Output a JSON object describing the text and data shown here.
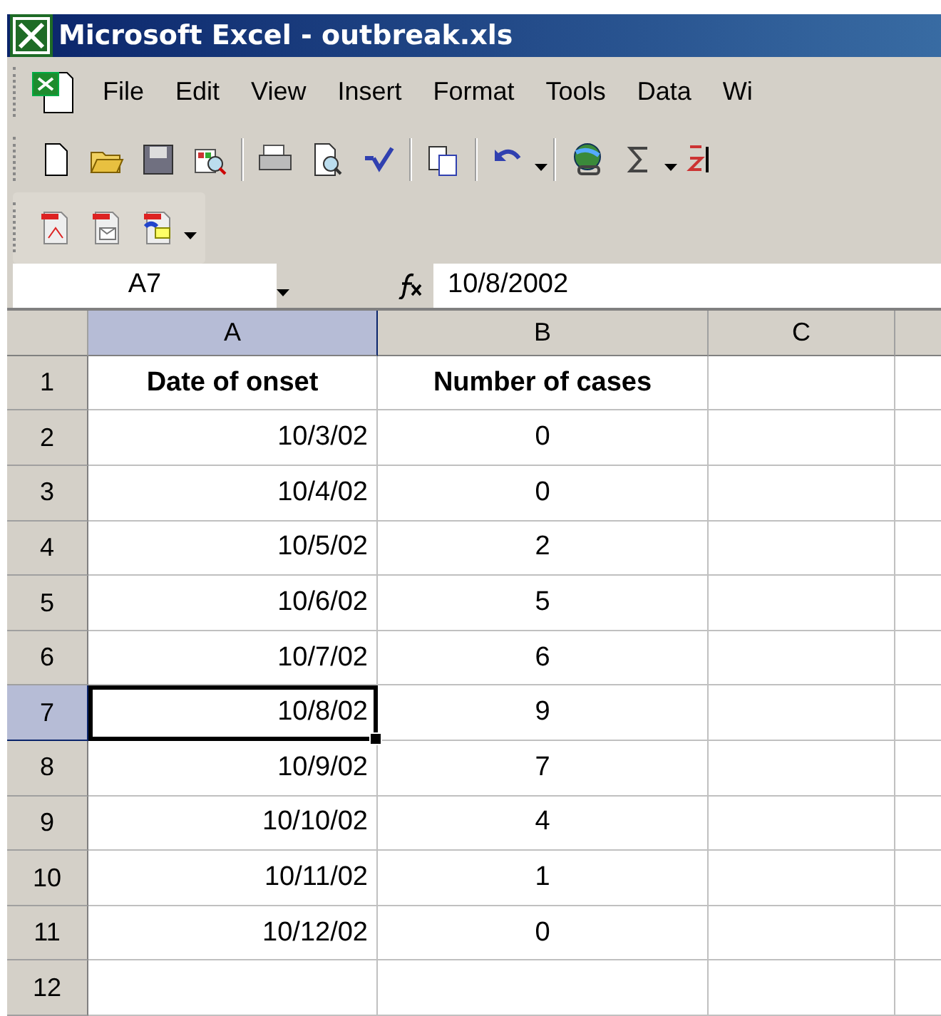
{
  "window": {
    "title": "Microsoft Excel - outbreak.xls"
  },
  "menu": [
    "File",
    "Edit",
    "View",
    "Insert",
    "Format",
    "Tools",
    "Data",
    "Wi"
  ],
  "name_box": {
    "value": "A7"
  },
  "formula_bar": {
    "value": "10/8/2002"
  },
  "columns": [
    {
      "label": "A",
      "selected": true
    },
    {
      "label": "B",
      "selected": false
    },
    {
      "label": "C",
      "selected": false
    },
    {
      "selected": false
    }
  ],
  "rows": [
    {
      "label": "1",
      "selected": false,
      "cells": [
        "Date of onset",
        "Number of cases"
      ]
    },
    {
      "label": "2",
      "selected": false,
      "cells": [
        "10/3/02",
        "0"
      ]
    },
    {
      "label": "3",
      "selected": false,
      "cells": [
        "10/4/02",
        "0"
      ]
    },
    {
      "label": "4",
      "selected": false,
      "cells": [
        "10/5/02",
        "2"
      ]
    },
    {
      "label": "5",
      "selected": false,
      "cells": [
        "10/6/02",
        "5"
      ]
    },
    {
      "label": "6",
      "selected": false,
      "cells": [
        "10/7/02",
        "6"
      ]
    },
    {
      "label": "7",
      "selected": true,
      "cells": [
        "10/8/02",
        "9"
      ]
    },
    {
      "label": "8",
      "selected": false,
      "cells": [
        "10/9/02",
        "7"
      ]
    },
    {
      "label": "9",
      "selected": false,
      "cells": [
        "10/10/02",
        "4"
      ]
    },
    {
      "label": "10",
      "selected": false,
      "cells": [
        "10/11/02",
        "1"
      ]
    },
    {
      "label": "11",
      "selected": false,
      "cells": [
        "10/12/02",
        "0"
      ]
    },
    {
      "label": "12",
      "selected": false,
      "cells": []
    }
  ]
}
